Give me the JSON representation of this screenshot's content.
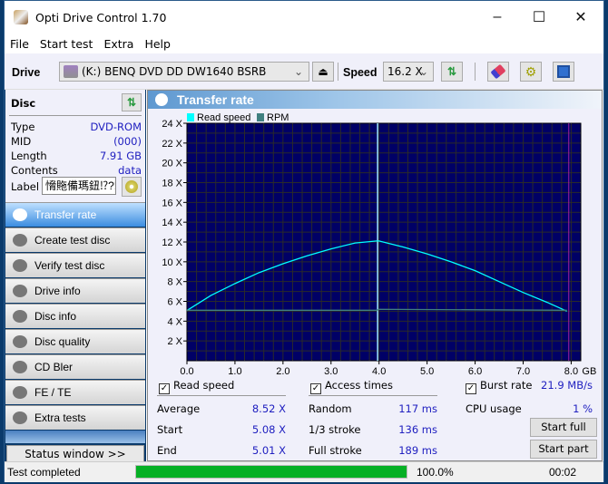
{
  "window": {
    "title": "Opti Drive Control 1.70",
    "minimize": "–",
    "maximize": "☐",
    "close": "✕"
  },
  "menu": [
    "File",
    "Start test",
    "Extra",
    "Help"
  ],
  "toolbar": {
    "drive_label": "Drive",
    "drive_value": "(K:)  BENQ DVD DD DW1640 BSRB",
    "speed_label": "Speed",
    "speed_value": "16.2 X"
  },
  "disc": {
    "heading": "Disc",
    "rows": [
      {
        "k": "Type",
        "v": "DVD-ROM"
      },
      {
        "k": "MID",
        "v": "(000)"
      },
      {
        "k": "Length",
        "v": "7.91 GB"
      },
      {
        "k": "Contents",
        "v": "data"
      }
    ],
    "label_key": "Label",
    "label_value": "愶䝯備瑪鈕⁉?!"
  },
  "nav": [
    "Transfer rate",
    "Create test disc",
    "Verify test disc",
    "Drive info",
    "Disc info",
    "Disc quality",
    "CD Bler",
    "FE / TE",
    "Extra tests"
  ],
  "nav_active": 0,
  "status_window_btn": "Status window >>",
  "panel_title": "Transfer rate",
  "chart_data": {
    "type": "line",
    "title": "Transfer rate",
    "legend": [
      "Read speed",
      "RPM"
    ],
    "legend_colors": [
      "#00ffff",
      "#408080"
    ],
    "xlabel": "GB",
    "ylabel": "X",
    "xlim": [
      0,
      8.2
    ],
    "ylim": [
      0,
      24
    ],
    "xticks": [
      "0.0",
      "1.0",
      "2.0",
      "3.0",
      "4.0",
      "5.0",
      "6.0",
      "7.0",
      "8.0"
    ],
    "yticks": [
      "2 X",
      "4 X",
      "6 X",
      "8 X",
      "10 X",
      "12 X",
      "14 X",
      "16 X",
      "18 X",
      "20 X",
      "22 X",
      "24 X"
    ],
    "grid": true,
    "disc_end_gb": 7.91,
    "layer_break_gb": 3.97,
    "series": [
      {
        "name": "Read speed",
        "x": [
          0,
          0.5,
          1.0,
          1.5,
          2.0,
          2.5,
          3.0,
          3.5,
          3.95,
          4.0,
          4.5,
          5.0,
          5.5,
          6.0,
          6.5,
          7.0,
          7.5,
          7.91
        ],
        "y": [
          5.08,
          6.6,
          7.8,
          8.9,
          9.8,
          10.6,
          11.3,
          11.9,
          12.1,
          12.1,
          11.5,
          10.8,
          10.0,
          9.1,
          8.0,
          6.9,
          5.9,
          5.01
        ]
      },
      {
        "name": "RPM",
        "x": [
          0,
          3.95,
          4.0,
          7.91
        ],
        "y": [
          5.1,
          5.1,
          5.2,
          5.1
        ]
      }
    ]
  },
  "stats": {
    "read_speed_label": "Read speed",
    "average_label": "Average",
    "average": "8.52 X",
    "start_label": "Start",
    "start": "5.08 X",
    "end_label": "End",
    "end": "5.01 X",
    "access_label": "Access times",
    "random_label": "Random",
    "random": "117 ms",
    "third_label": "1/3 stroke",
    "third": "136 ms",
    "full_label": "Full stroke",
    "full": "189 ms",
    "burst_label": "Burst rate",
    "burst": "21.9 MB/s",
    "cpu_label": "CPU usage",
    "cpu": "1 %",
    "start_full": "Start full",
    "start_part": "Start part"
  },
  "statusbar": {
    "text": "Test completed",
    "progress": 100.0,
    "progress_text": "100.0%",
    "time": "00:02"
  }
}
